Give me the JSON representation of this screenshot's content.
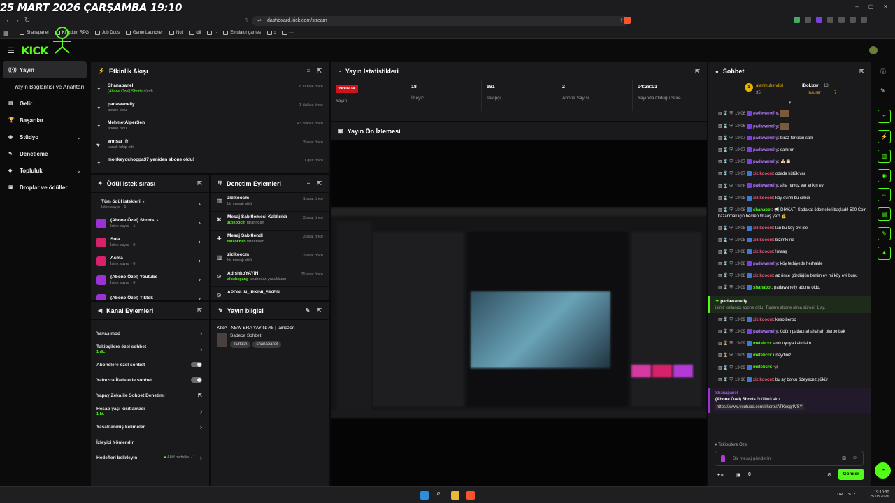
{
  "overlay": {
    "datetime": "25 MART 2026 ÇARŞAMBA 19:10"
  },
  "browser": {
    "url": "dashboard.kick.com/stream"
  },
  "bookmarks": [
    "Shanapanel",
    "Kingdom RPG",
    "Job Docs",
    "Game Launcher",
    "Null",
    "dil",
    "··",
    "Emulator games",
    "x",
    "···"
  ],
  "brand": {
    "logo": "KICK",
    "accent": "#53fc18"
  },
  "sidebar": {
    "items": [
      {
        "label": "Yayın",
        "icon": "broadcast-icon",
        "active": true
      },
      {
        "label": "Yayın Bağlantısı ve Anahtarı",
        "icon": ""
      },
      {
        "label": "Gelir",
        "icon": "wallet-icon"
      },
      {
        "label": "Başarılar",
        "icon": "trophy-icon"
      },
      {
        "label": "Stüdyo",
        "icon": "studio-icon",
        "chevron": true
      },
      {
        "label": "Denetleme",
        "icon": "wrench-icon"
      },
      {
        "label": "Topluluk",
        "icon": "users-icon",
        "chevron": true
      },
      {
        "label": "Droplar ve ödüller",
        "icon": "gift-icon"
      }
    ]
  },
  "activity": {
    "title": "Etkinlik Akışı",
    "items": [
      {
        "name": "Shanapanel",
        "sub": "(Abone Özel) Shorts",
        "sub2": " alındı",
        "time": "8 saniye önce",
        "icon": "reward-icon"
      },
      {
        "name": "padawanelly",
        "sub": "abone oldu",
        "time": "1 dakika önce",
        "icon": "star-icon"
      },
      {
        "name": "MehmetAlperSen",
        "sub": "abone oldu",
        "time": "43 dakika önce",
        "icon": "star-icon"
      },
      {
        "name": "ennsar_fr",
        "sub": "kanalı takip etti",
        "time": "3 saat önce",
        "icon": "heart-icon"
      },
      {
        "name": "monkeydchoppa37 yeniden abone oldu!",
        "sub": "",
        "time": "1 gün önce",
        "icon": "star-icon"
      }
    ]
  },
  "stats": {
    "title": "Yayın İstatistikleri",
    "live_badge": "YAYINDA",
    "live_label": "Yayın",
    "items": [
      {
        "value": "18",
        "label": "İzleyici"
      },
      {
        "value": "591",
        "label": "Takipçi"
      },
      {
        "value": "2",
        "label": "Abone Sayısı"
      },
      {
        "value": "04:28:01",
        "label": "Yayında Olduğu Süre"
      }
    ]
  },
  "preview": {
    "title": "Yayın Ön İzlemesi"
  },
  "rewards": {
    "title": "Ödül istek sırası",
    "items": [
      {
        "name": "Tüm ödül istekleri",
        "sub": "İstek sayısı · 1",
        "color": "",
        "dot": true
      },
      {
        "name": "(Abone Özel) Shorts",
        "sub": "İstek sayısı · 1",
        "color": "#9b32d6",
        "dot": true
      },
      {
        "name": "Sula",
        "sub": "İstek sayısı · 0",
        "color": "#d6226a",
        "dot": false
      },
      {
        "name": "Asma",
        "sub": "İstek sayısı · 0",
        "color": "#d6226a",
        "dot": false
      },
      {
        "name": "(Abone Özel) Youtube",
        "sub": "İstek sayısı · 0",
        "color": "#9b32d6",
        "dot": false
      },
      {
        "name": "(Abone Özel) Tiktok",
        "sub": "",
        "color": "#9b32d6",
        "dot": false
      }
    ]
  },
  "moderation": {
    "title": "Denetim Eylemleri",
    "items": [
      {
        "name": "zizikoocm",
        "sub": "bir mesajı sildi",
        "who": "",
        "time": "1 saat önce",
        "icon": "trash-icon"
      },
      {
        "name": "Mesaj Sabitlemesi Kaldırıldı",
        "sub": " tarafından",
        "who": "zizikoocm",
        "time": "3 saat önce",
        "icon": "unpin-icon"
      },
      {
        "name": "Mesaj Sabitlendi",
        "sub": " tarafından",
        "who": "Nusokhan",
        "time": "3 saat önce",
        "icon": "pin-icon"
      },
      {
        "name": "zizikoocm",
        "sub": "bir mesajı sildi",
        "who": "",
        "time": "3 saat önce",
        "icon": "trash-icon"
      },
      {
        "name": "AdishkoYAYIN",
        "sub": " tarafından yasaklandı",
        "who": "aloskegang",
        "time": "15 saat önce",
        "icon": "ban-icon"
      },
      {
        "name": "APONUN_IRKINI_SIKEN",
        "sub": "",
        "who": "",
        "time": "",
        "icon": "ban-icon"
      }
    ]
  },
  "channel": {
    "title": "Kanal Eylemleri",
    "items": [
      {
        "label": "Yavaş mod",
        "sub": "",
        "control": "chevron"
      },
      {
        "label": "Takipçilere özel sohbet",
        "sub": "1 dk.",
        "control": "chevron"
      },
      {
        "label": "Abonelere özel sohbet",
        "sub": "",
        "control": "toggle"
      },
      {
        "label": "Yalnızca İfadelerle sohbet",
        "sub": "",
        "control": "toggle"
      },
      {
        "label": "Yapay Zeka ile Sohbet Denetimi",
        "sub": "",
        "control": "external"
      },
      {
        "label": "Hesap yaşı kısıtlaması",
        "sub": "1 hf.",
        "control": "chevron"
      },
      {
        "label": "Yasaklanmış kelimeler",
        "sub": "",
        "control": "chevron"
      },
      {
        "label": "İzleyici Yönlendir",
        "sub": "",
        "control": "none"
      },
      {
        "label": "Hedefleri belirleyin",
        "sub": "",
        "control": "chevron",
        "extra": "Aktif hedefler · 1"
      }
    ]
  },
  "info": {
    "title": "Yayın bilgisi",
    "stream_title": "KISA - NEW ERA YAYIN: #8 | !amazon",
    "category": "Sadece Sohbet",
    "tags": [
      "Turkish",
      "shanapanel"
    ]
  },
  "chat": {
    "title": "Sohbet",
    "top": {
      "user1": "atarimuhendisi",
      "user1_count": "35",
      "user2": "iBoLizer",
      "user2_count": "13",
      "user2_sub": "Insurer",
      "user2_sub_count": "7"
    },
    "messages": [
      {
        "time": "19:06",
        "user": "padawanelly",
        "color": "#b57bff",
        "text": ""
      },
      {
        "time": "19:06",
        "user": "padawanelly",
        "color": "#b57bff",
        "text": ""
      },
      {
        "time": "19:07",
        "user": "padawanelly",
        "color": "#b57bff",
        "text": "biraz farkısın sanı"
      },
      {
        "time": "19:07",
        "user": "padawanelly",
        "color": "#b57bff",
        "text": "sanırım"
      },
      {
        "time": "19:07",
        "user": "padawanelly",
        "color": "#b57bff",
        "text": "👍🏻👋🏻"
      },
      {
        "time": "19:07",
        "user": "zizikoocm",
        "color": "#ff5a7a",
        "text": "odada kütük var"
      },
      {
        "time": "19:08",
        "user": "padawanelly",
        "color": "#b57bff",
        "text": "aha havuz var erikin ev"
      },
      {
        "time": "19:08",
        "user": "zizikoocm",
        "color": "#ff5a7a",
        "text": "köy evimi bu şimdi"
      },
      {
        "time": "19:08",
        "user": "shanabot",
        "color": "#53fc18",
        "text": "📢 DİKKAT! Sadakat ödemeleri başladı! 500 Coin kazanmak için hemen !maaş yaz! 💰"
      },
      {
        "time": "19:08",
        "user": "zizikoocm",
        "color": "#ff5a7a",
        "text": "lan bu köy evi ise"
      },
      {
        "time": "19:08",
        "user": "zizikoocm",
        "color": "#ff5a7a",
        "text": "bizimki ne"
      },
      {
        "time": "19:08",
        "user": "zizikoocm",
        "color": "#ff5a7a",
        "text": "!maaş"
      },
      {
        "time": "19:08",
        "user": "padawanelly",
        "color": "#b57bff",
        "text": "köy fethiyede herhalde"
      },
      {
        "time": "19:08",
        "user": "zizikoocm",
        "color": "#ff5a7a",
        "text": "az önce gördüğün benim ev mi köy evi bunu"
      },
      {
        "time": "19:09",
        "user": "shanabot",
        "color": "#53fc18",
        "text": "padawanelly abone oldu."
      }
    ],
    "sub_event": {
      "user": "padawanelly",
      "text": "isimli kullanıcı abone oldu! Toplam abone olma süresi: 1 ay."
    },
    "messages2": [
      {
        "time": "19:09",
        "user": "zizikoocm",
        "color": "#ff5a7a",
        "text": "keso beroo"
      },
      {
        "time": "19:09",
        "user": "padawanelly",
        "color": "#b57bff",
        "text": "ödüm patladı ahahahah bierbe bak"
      },
      {
        "time": "19:09",
        "user": "metebcrr",
        "color": "#53fc18",
        "text": "amk uyuya kalmisim"
      },
      {
        "time": "19:09",
        "user": "metebcrr",
        "color": "#53fc18",
        "text": "unaydiniz"
      },
      {
        "time": "19:09",
        "user": "metebcrr",
        "color": "#53fc18",
        "text": "🦋"
      },
      {
        "time": "19:10",
        "user": "zizikoocm",
        "color": "#ff5a7a",
        "text": "bu ay borcu ödeyecez şükür"
      }
    ],
    "reward_event": {
      "user": "Shanapanel",
      "reward": "(Abone Özel) Shorts",
      "suffix": " ödülünü aldı",
      "link": "https://www.youtube.com/shorts/ATKxsgrIVSY"
    },
    "followers_only": "Takipçilere Özel",
    "input_placeholder": "Bir mesaj gönderin",
    "send": "Gönder",
    "footer_count": "0"
  },
  "taskbar": {
    "lang": "TUR",
    "time": "19:10:30",
    "date": "25.03.2026"
  }
}
